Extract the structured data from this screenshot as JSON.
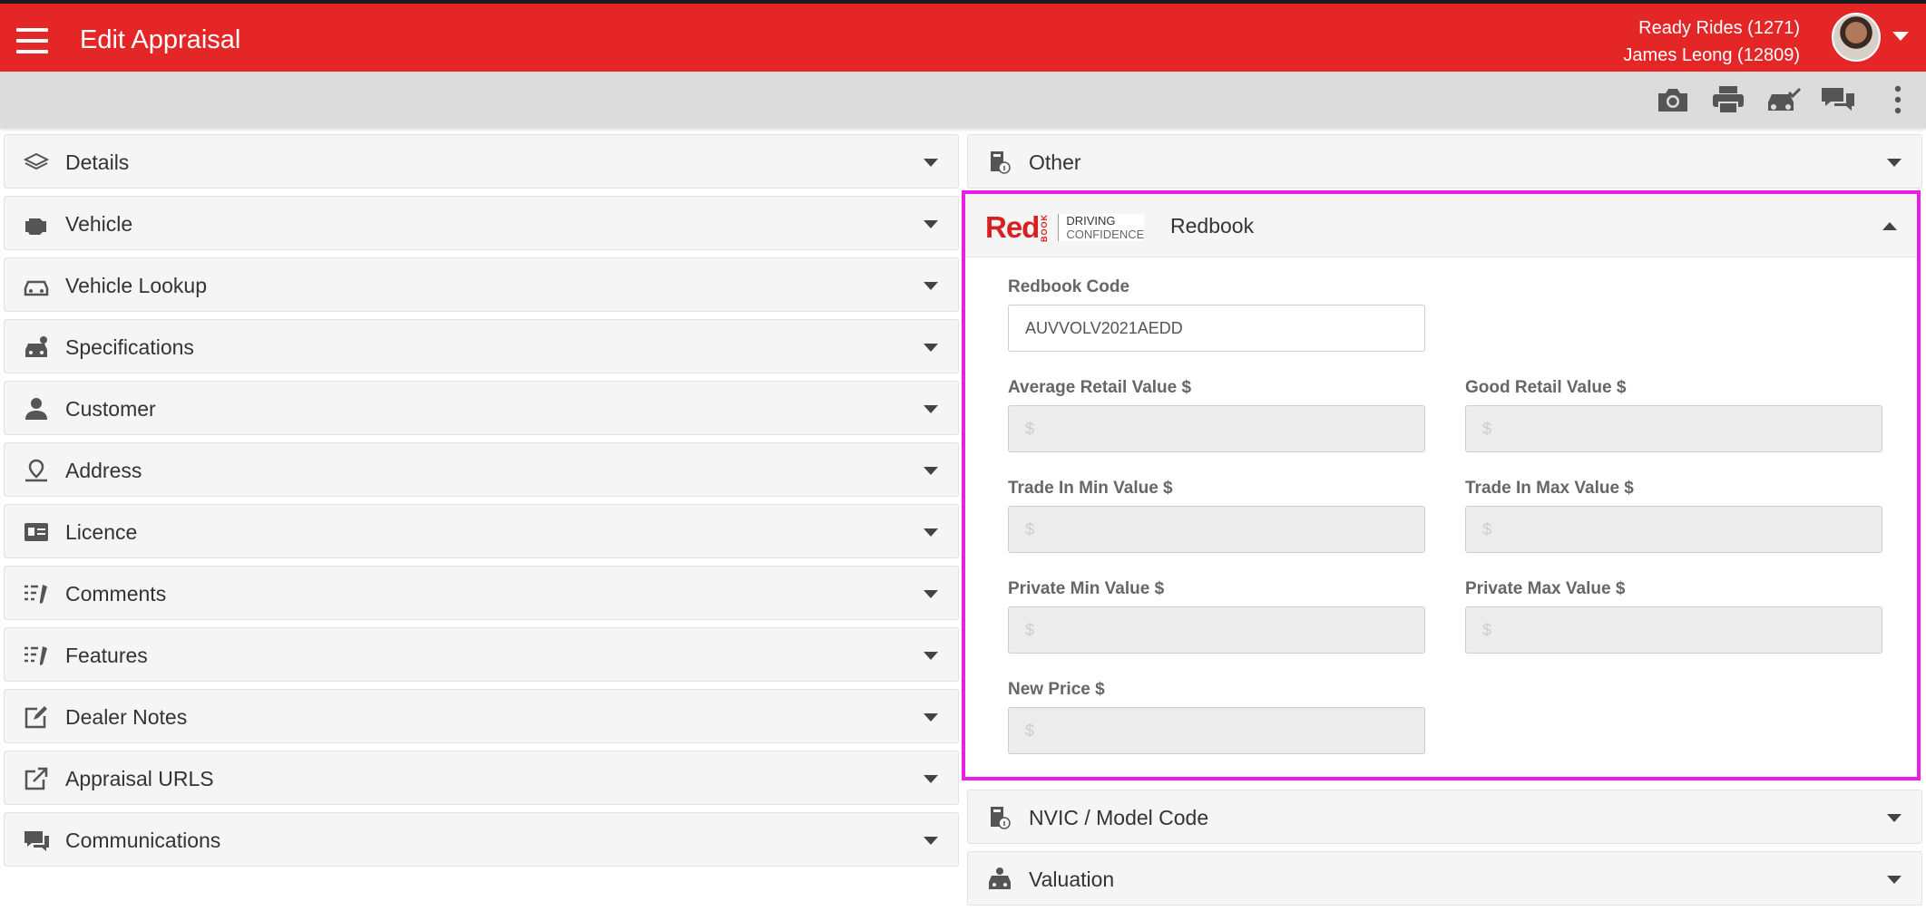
{
  "header": {
    "title": "Edit Appraisal",
    "dealer": "Ready Rides (1271)",
    "user": "James Leong (12809)",
    "bg_color": "#e52626"
  },
  "toolbar": {
    "icons": [
      "camera-icon",
      "print-icon",
      "car-check-icon",
      "chat-icon",
      "more-vert-icon"
    ]
  },
  "left_panels": [
    {
      "label": "Details",
      "icon": "layers-icon"
    },
    {
      "label": "Vehicle",
      "icon": "engine-icon"
    },
    {
      "label": "Vehicle Lookup",
      "icon": "car-search-icon"
    },
    {
      "label": "Specifications",
      "icon": "car-gear-icon"
    },
    {
      "label": "Customer",
      "icon": "person-icon"
    },
    {
      "label": "Address",
      "icon": "map-pin-icon"
    },
    {
      "label": "Licence",
      "icon": "id-card-icon"
    },
    {
      "label": "Comments",
      "icon": "checklist-pen-icon"
    },
    {
      "label": "Features",
      "icon": "checklist-pen-icon"
    },
    {
      "label": "Dealer Notes",
      "icon": "edit-note-icon"
    },
    {
      "label": "Appraisal URLS",
      "icon": "external-link-icon"
    },
    {
      "label": "Communications",
      "icon": "chat-icon"
    }
  ],
  "right_panels": {
    "other": {
      "label": "Other",
      "icon": "info-doc-icon"
    },
    "nvic": {
      "label": "NVIC / Model Code",
      "icon": "info-doc-icon"
    },
    "valuation": {
      "label": "Valuation",
      "icon": "car-money-icon"
    }
  },
  "redbook": {
    "title": "Redbook",
    "logo_text": "Red",
    "logo_sub": "BOOK",
    "tagline_1": "DRIVING",
    "tagline_2": "CONFIDENCE",
    "code_label": "Redbook Code",
    "code_value": "AUVVOLV2021AEDD",
    "fields": {
      "avg_retail_label": "Average Retail Value $",
      "good_retail_label": "Good Retail Value $",
      "trade_min_label": "Trade In Min Value $",
      "trade_max_label": "Trade In Max Value $",
      "private_min_label": "Private Min Value $",
      "private_max_label": "Private Max Value $",
      "new_price_label": "New Price $",
      "placeholder": "$"
    },
    "highlight_color": "#e81ee8"
  }
}
